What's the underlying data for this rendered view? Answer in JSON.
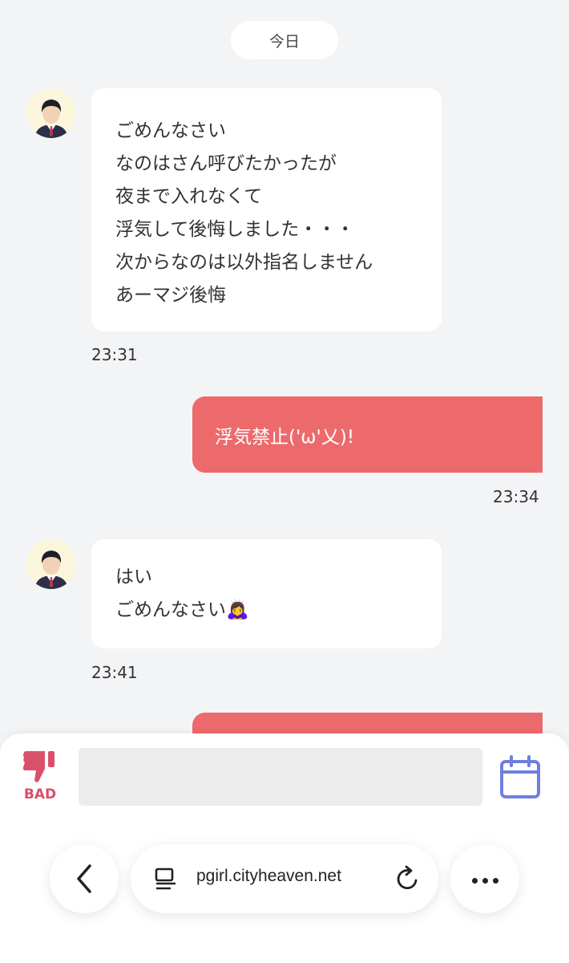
{
  "date_divider": "今日",
  "messages": [
    {
      "direction": "incoming",
      "lines": [
        "ごめんなさい",
        "なのはさん呼びたかったが",
        "夜まで入れなくて",
        "浮気して後悔しました・・・",
        "次からなのは以外指名しません",
        "あーマジ後悔"
      ],
      "time": "23:31"
    },
    {
      "direction": "outgoing",
      "lines": [
        "浮気禁止('ω'乂)!"
      ],
      "time": "23:34"
    },
    {
      "direction": "incoming",
      "lines": [
        "はい",
        "ごめんなさい🙇‍♀️"
      ],
      "time": "23:41"
    }
  ],
  "composer": {
    "bad_label": "BAD",
    "input_value": ""
  },
  "browser": {
    "url": "pgirl.cityheaven.net"
  },
  "colors": {
    "outgoing_bubble": "#ec6a6c",
    "bad_accent": "#d9506b",
    "calendar_accent": "#6f7fe0",
    "background": "#f3f4f6"
  },
  "icons": {
    "bad": "thumbs-down-icon",
    "calendar": "calendar-icon",
    "back": "chevron-left-icon",
    "tabs": "tab-list-icon",
    "reload": "reload-icon",
    "more": "more-icon"
  }
}
